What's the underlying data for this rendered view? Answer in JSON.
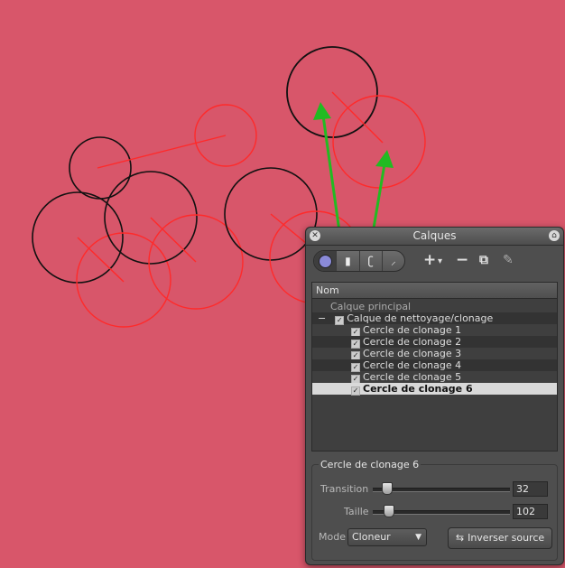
{
  "colors": {
    "background": "#d8566a",
    "accent_arrow": "#22bb22",
    "source_circle": "#111111",
    "target_circle": "#ff2a2a"
  },
  "panel": {
    "title": "Calques",
    "close_icon": "close-icon",
    "home_icon": "home-icon",
    "toolbar": {
      "tools": [
        "circle-tool-icon",
        "rect-tool-icon",
        "bezier-tool-icon",
        "brush-tool-icon"
      ],
      "add_label": "+",
      "add_menu_label": "▾",
      "remove_label": "−",
      "duplicate_icon": "duplicate-layer-icon",
      "edit_icon": "edit-layer-icon"
    },
    "list": {
      "header": "Nom",
      "rows": [
        {
          "label": "Calque principal"
        },
        {
          "label": "Calque de nettoyage/clonage",
          "expander": "−"
        },
        {
          "label": "Cercle de clonage 1"
        },
        {
          "label": "Cercle de clonage 2"
        },
        {
          "label": "Cercle de clonage 3"
        },
        {
          "label": "Cercle de clonage 4"
        },
        {
          "label": "Cercle de clonage 5"
        },
        {
          "label": "Cercle de clonage 6",
          "selected": true
        }
      ]
    },
    "properties": {
      "group_title": "Cercle de clonage 6",
      "transition_label": "Transition",
      "transition_value": "32",
      "size_label": "Taille",
      "size_value": "102",
      "mode_label": "Mode",
      "mode_value": "Cloneur",
      "invert_button": "Inverser source"
    }
  }
}
